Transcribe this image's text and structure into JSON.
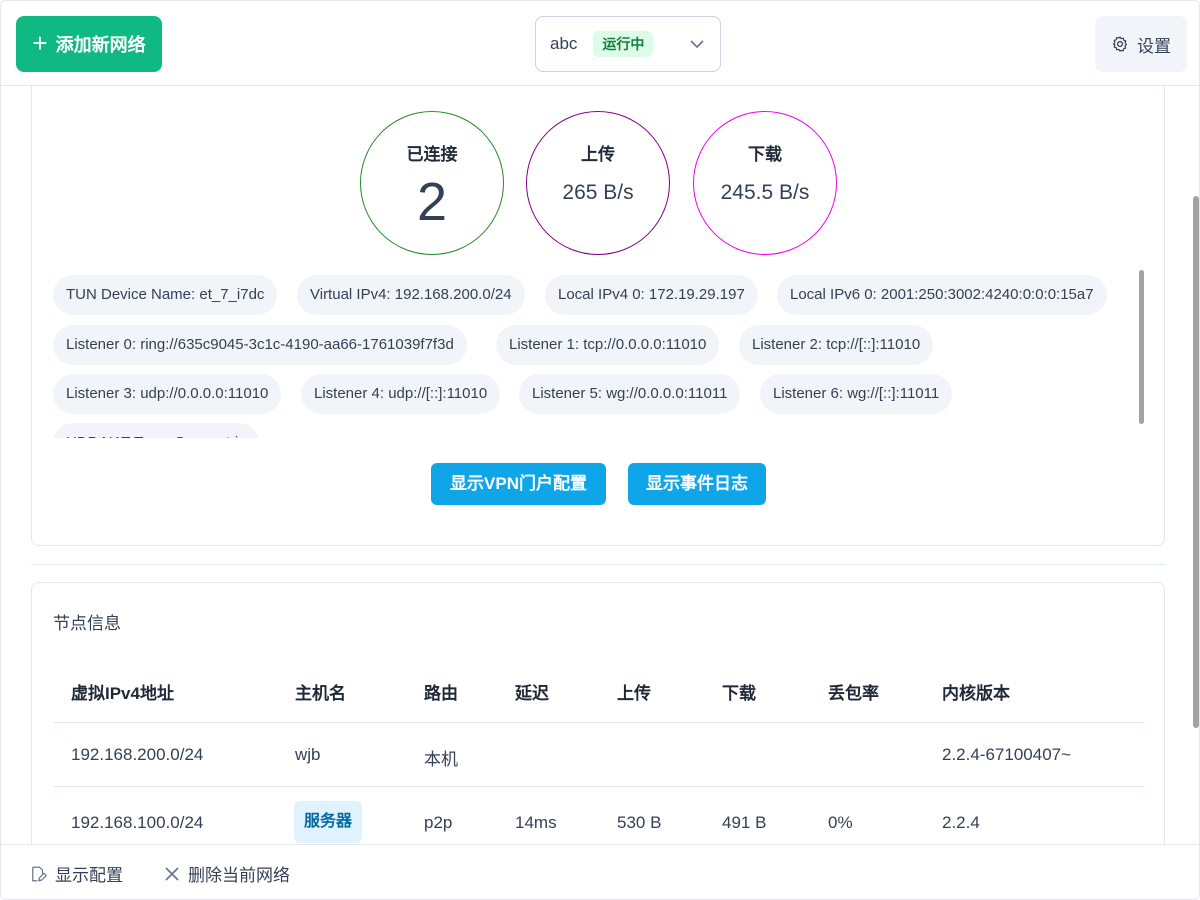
{
  "header": {
    "add_label": "添加新网络",
    "network_name": "abc",
    "status_badge": "运行中",
    "settings_label": "设置"
  },
  "stats": {
    "connected_label": "已连接",
    "connected_value": "2",
    "upload_label": "上传",
    "upload_value": "265 B/s",
    "download_label": "下载",
    "download_value": "245.5 B/s"
  },
  "tags": [
    "TUN Device Name: et_7_i7dc",
    "Virtual IPv4: 192.168.200.0/24",
    "Local IPv4 0: 172.19.29.197",
    "Local IPv6 0: 2001:250:3002:4240:0:0:0:15a7",
    "Listener 0: ring://635c9045-3c1c-4190-aa66-1761039f7f3d",
    "Listener 1: tcp://0.0.0.0:11010",
    "Listener 2: tcp://[::]:11010",
    "Listener 3: udp://0.0.0.0:11010",
    "Listener 4: udp://[::]:11010",
    "Listener 5: wg://0.0.0.0:11011",
    "Listener 6: wg://[::]:11011",
    "UDP NAT Type: Symmetric"
  ],
  "actions": {
    "vpn_portal": "显示VPN门户配置",
    "event_log": "显示事件日志"
  },
  "nodes": {
    "title": "节点信息",
    "headers": [
      "虚拟IPv4地址",
      "主机名",
      "路由",
      "延迟",
      "上传",
      "下载",
      "丢包率",
      "内核版本"
    ],
    "rows": [
      [
        "192.168.200.0/24",
        "wjb",
        "本机",
        "",
        "",
        "",
        "",
        "2.2.4-67100407~"
      ],
      [
        "192.168.100.0/24",
        "服务器",
        "p2p",
        "14ms",
        "530 B",
        "491 B",
        "0%",
        "2.2.4"
      ]
    ]
  },
  "footer": {
    "show_config": "显示配置",
    "delete_network": "删除当前网络"
  }
}
